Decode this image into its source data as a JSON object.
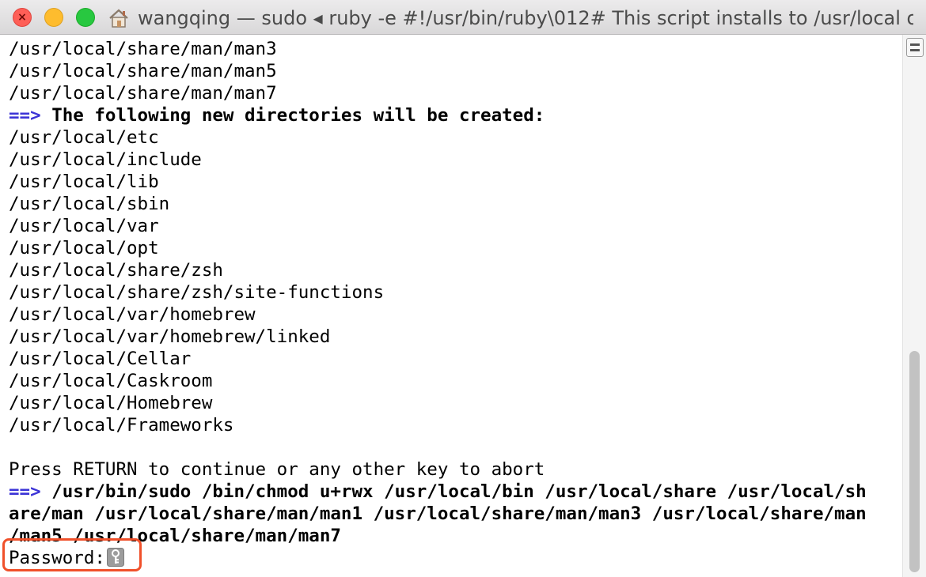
{
  "window": {
    "title": "wangqing — sudo ◂ ruby -e #!/usr/bin/ruby\\012# This script installs to /usr/local o...",
    "icons": [
      "close-icon",
      "minimize-icon",
      "maximize-icon",
      "home-icon"
    ]
  },
  "terminal": {
    "arrow": "==>",
    "lines": [
      "/usr/local/share/man/man3",
      "/usr/local/share/man/man5",
      "/usr/local/share/man/man7",
      "The following new directories will be created:",
      "/usr/local/etc",
      "/usr/local/include",
      "/usr/local/lib",
      "/usr/local/sbin",
      "/usr/local/var",
      "/usr/local/opt",
      "/usr/local/share/zsh",
      "/usr/local/share/zsh/site-functions",
      "/usr/local/var/homebrew",
      "/usr/local/var/homebrew/linked",
      "/usr/local/Cellar",
      "/usr/local/Caskroom",
      "/usr/local/Homebrew",
      "/usr/local/Frameworks",
      "",
      "Press RETURN to continue or any other key to abort",
      "/usr/bin/sudo /bin/chmod u+rwx /usr/local/bin /usr/local/share /usr/local/sh",
      "are/man /usr/local/share/man/man1 /usr/local/share/man/man3 /usr/local/share/man",
      "/man5 /usr/local/share/man/man7"
    ],
    "password_prompt": "Password:",
    "cursor_icon": "key-icon"
  },
  "colors": {
    "arrow": "#3b33d6",
    "highlight_box": "#f0502a"
  }
}
